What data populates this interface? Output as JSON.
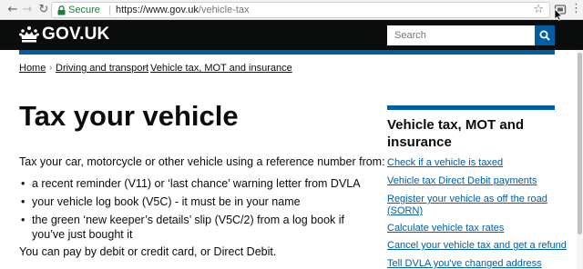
{
  "browser": {
    "secure_label": "Secure",
    "url_separator": "|",
    "url_host": "https://www.gov.uk",
    "url_path": "/vehicle-tax"
  },
  "header": {
    "logo_text": "GOV.UK",
    "search_placeholder": "Search"
  },
  "breadcrumbs": [
    {
      "label": "Home"
    },
    {
      "label": "Driving and transport"
    },
    {
      "label": "Vehicle tax, MOT and insurance"
    }
  ],
  "main": {
    "title": "Tax your vehicle",
    "intro": "Tax your car, motorcycle or other vehicle using a reference number from:",
    "bullets": [
      "a recent reminder (V11) or ‘last chance’ warning letter from DVLA",
      "your vehicle log book (V5C) - it must be in your name",
      "the green ‘new keeper’s details’ slip (V5C/2) from a log book if you’ve just bought it"
    ],
    "payment": "You can pay by debit or credit card, or Direct Debit."
  },
  "sidebar": {
    "title": "Vehicle tax, MOT and insurance",
    "links": [
      "Check if a vehicle is taxed",
      "Vehicle tax Direct Debit payments",
      "Register your vehicle as off the road",
      "(SORN)",
      "Calculate vehicle tax rates",
      "Cancel your vehicle tax and get a refund",
      "Tell DVLA you've changed address"
    ]
  },
  "colors": {
    "header_bg": "#0b0c0c",
    "brand_blue": "#005ea5",
    "link": "#005ea5",
    "secure_green": "#188038"
  }
}
